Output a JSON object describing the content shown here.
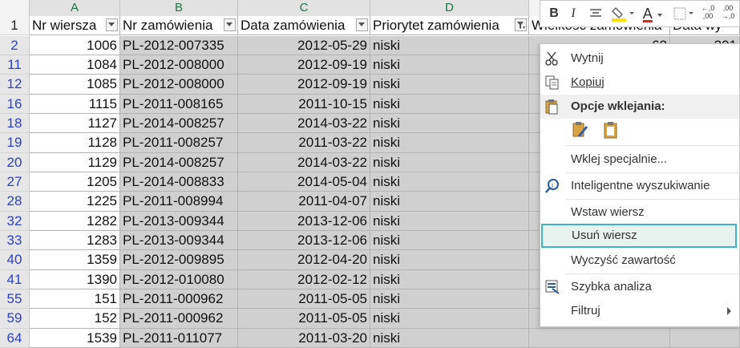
{
  "columns": [
    {
      "letter": "A"
    },
    {
      "letter": "B"
    },
    {
      "letter": "C"
    },
    {
      "letter": "D"
    },
    {
      "letter": ""
    }
  ],
  "header_row": {
    "row_number": "1",
    "headers": [
      "Nr wiersza",
      "Nr zamówienia",
      "Data zamówienia",
      "Priorytet zamówienia",
      "Wielkość zamówienia",
      "Data wy"
    ]
  },
  "rows": [
    {
      "row": "2",
      "nr": "1006",
      "order": "PL-2012-007335",
      "date": "2012-05-29",
      "priority": "niski",
      "extra": "62",
      "extra2": "201"
    },
    {
      "row": "11",
      "nr": "1084",
      "order": "PL-2012-008000",
      "date": "2012-09-19",
      "priority": "niski"
    },
    {
      "row": "12",
      "nr": "1085",
      "order": "PL-2012-008000",
      "date": "2012-09-19",
      "priority": "niski"
    },
    {
      "row": "16",
      "nr": "1115",
      "order": "PL-2011-008165",
      "date": "2011-10-15",
      "priority": "niski"
    },
    {
      "row": "18",
      "nr": "1127",
      "order": "PL-2014-008257",
      "date": "2014-03-22",
      "priority": "niski"
    },
    {
      "row": "19",
      "nr": "1128",
      "order": "PL-2011-008257",
      "date": "2011-03-22",
      "priority": "niski"
    },
    {
      "row": "20",
      "nr": "1129",
      "order": "PL-2014-008257",
      "date": "2014-03-22",
      "priority": "niski"
    },
    {
      "row": "27",
      "nr": "1205",
      "order": "PL-2014-008833",
      "date": "2014-05-04",
      "priority": "niski"
    },
    {
      "row": "28",
      "nr": "1225",
      "order": "PL-2011-008994",
      "date": "2011-04-07",
      "priority": "niski"
    },
    {
      "row": "32",
      "nr": "1282",
      "order": "PL-2013-009344",
      "date": "2013-12-06",
      "priority": "niski"
    },
    {
      "row": "33",
      "nr": "1283",
      "order": "PL-2013-009344",
      "date": "2013-12-06",
      "priority": "niski"
    },
    {
      "row": "40",
      "nr": "1359",
      "order": "PL-2012-009895",
      "date": "2012-04-20",
      "priority": "niski"
    },
    {
      "row": "41",
      "nr": "1390",
      "order": "PL-2012-010080",
      "date": "2012-02-12",
      "priority": "niski"
    },
    {
      "row": "55",
      "nr": "151",
      "order": "PL-2011-000962",
      "date": "2011-05-05",
      "priority": "niski"
    },
    {
      "row": "59",
      "nr": "152",
      "order": "PL-2011-000962",
      "date": "2011-05-05",
      "priority": "niski"
    },
    {
      "row": "64",
      "nr": "1539",
      "order": "PL-2011-011077",
      "date": "2011-03-20",
      "priority": "niski"
    }
  ],
  "mini_toolbar": {
    "bold": "B",
    "italic": "I",
    "font_color_letter": "A",
    "decrease_decimal_top": "←,0",
    "decrease_decimal_bottom": ",00",
    "increase_decimal_top": ",00",
    "increase_decimal_bottom": "→,0",
    "font_color": "#e02020",
    "fill_color": "#ffe000"
  },
  "context_menu": {
    "cut": "Wytnij",
    "copy": "Kopiuj",
    "paste_options": "Opcje wklejania:",
    "paste_special": "Wklej specjalnie...",
    "smart_lookup": "Inteligentne wyszukiwanie",
    "insert_row": "Wstaw wiersz",
    "delete_row": "Usuń wiersz",
    "clear_contents": "Wyczyść zawartość",
    "quick_analysis": "Szybka analiza",
    "filter": "Filtruj",
    "accent_color": "#3bb3c9"
  }
}
